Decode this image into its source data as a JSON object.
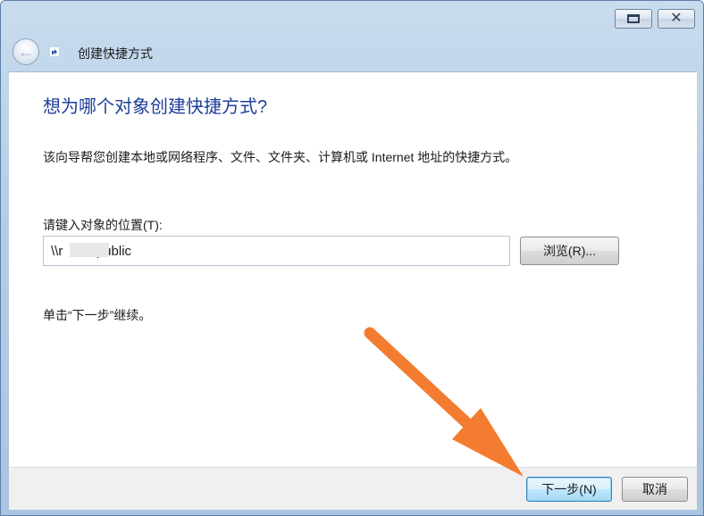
{
  "window": {
    "title": "创建快捷方式",
    "restore_icon": "restore-icon",
    "close_icon": "close-icon",
    "back_icon": "back-arrow-icon"
  },
  "main": {
    "heading": "想为哪个对象创建快捷方式?",
    "description": "该向导帮您创建本地或网络程序、文件、文件夹、计算机或 Internet 地址的快捷方式。",
    "location_label": "请键入对象的位置(T):",
    "location_value": "\\\\r        \\public",
    "browse_label": "浏览(R)...",
    "hint": "单击“下一步”继续。"
  },
  "footer": {
    "next_label": "下一步(N)",
    "cancel_label": "取消"
  },
  "colors": {
    "heading": "#1e3f9a",
    "annotation_arrow": "#f47c30",
    "frame": "#b6cde6"
  }
}
